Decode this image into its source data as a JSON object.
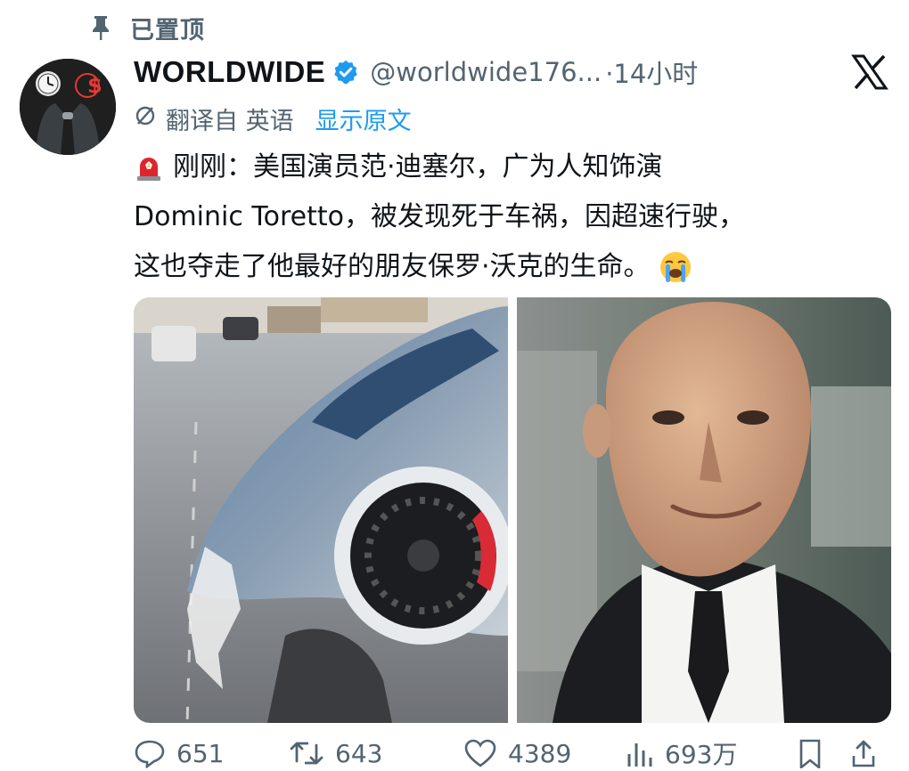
{
  "pinned": {
    "label": "已置顶",
    "icon": "pin-icon"
  },
  "author": {
    "name": "WORLDWIDE",
    "handle": "@worldwide176...",
    "time": "·14小时",
    "verified_color": "#1d9bf0",
    "avatar": "avatar-icon"
  },
  "translation": {
    "icon": "translate-icon",
    "from": "翻译自 英语",
    "show_original": "显示原文"
  },
  "tweet": {
    "lines": [
      "刚刚：美国演员范·迪塞尔，广为人知饰演",
      "Dominic Toretto，被发现死于车祸，因超速行驶，",
      "这也夺走了他最好的朋友保罗·沃克的生命。"
    ],
    "leading_emoji": "siren-icon",
    "trailing_emoji": "crying-face-icon"
  },
  "media": [
    {
      "name": "crashed-car-photo"
    },
    {
      "name": "actor-portrait-photo"
    }
  ],
  "actions": {
    "replies": "651",
    "reposts": "643",
    "likes": "4389",
    "views": "693万"
  },
  "colors": {
    "accent": "#1d9bf0",
    "muted": "#536471",
    "text": "#0f1419"
  }
}
